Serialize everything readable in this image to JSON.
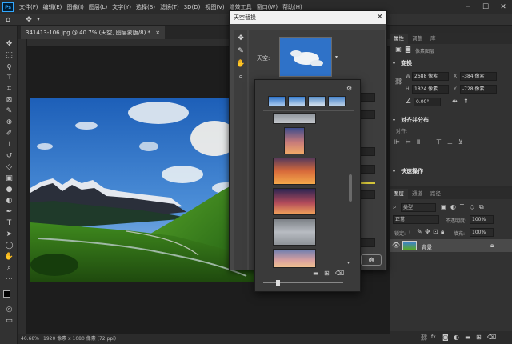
{
  "menubar": {
    "logo": "Ps",
    "items": [
      "文件(F)",
      "编辑(E)",
      "图像(I)",
      "图层(L)",
      "文字(Y)",
      "选择(S)",
      "滤镜(T)",
      "3D(D)",
      "视图(V)",
      "增效工具",
      "窗口(W)",
      "帮助(H)"
    ]
  },
  "document": {
    "tab_label": "341413-106.jpg @ 40.7% (天空, 图层蒙版/8) *",
    "tab_close": "×"
  },
  "status": {
    "zoom": "40.68%",
    "doc_info": "1920 像素 x 1080 像素 (72 ppi)",
    "arrow": "›"
  },
  "dialog": {
    "title": "天空替换",
    "close": "✕",
    "sky_label": "天空:",
    "ok_partial": "确"
  },
  "properties": {
    "tabs": [
      "属性",
      "调整",
      "库"
    ],
    "layer_type": "像素图层",
    "transform_title": "变换",
    "w_label": "W",
    "w_value": "2688 像素",
    "x_label": "X",
    "x_value": "-384 像素",
    "h_label": "H",
    "h_value": "1824 像素",
    "y_label": "Y",
    "y_value": "-728 像素",
    "angle_value": "0.00°",
    "align_title": "对齐并分布",
    "align_sub": "对齐:",
    "quick_title": "快速操作"
  },
  "layers": {
    "tabs": [
      "图层",
      "通道",
      "路径"
    ],
    "search_kind": "类型",
    "blend_mode": "正常",
    "opacity_label": "不透明度:",
    "opacity_value": "100%",
    "lock_label": "锁定:",
    "fill_label": "填充:",
    "fill_value": "100%",
    "layer_name": "背景"
  },
  "colors": {
    "accent": "#31a8ff",
    "panel": "#323232",
    "dark": "#262626",
    "dialog": "#474747"
  }
}
